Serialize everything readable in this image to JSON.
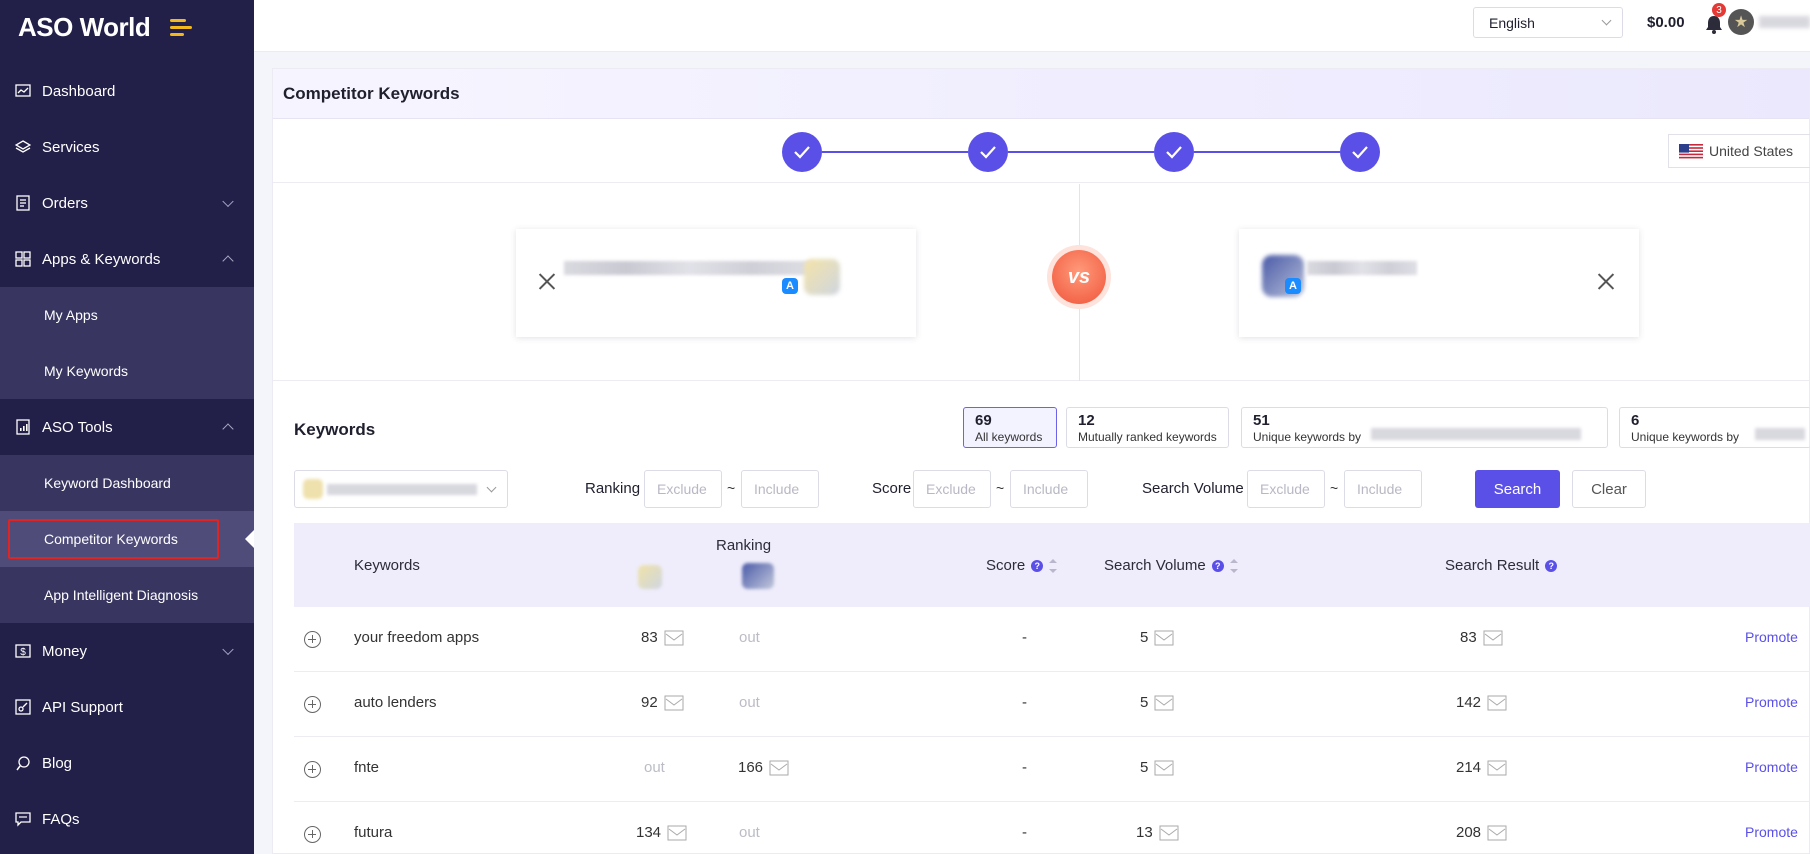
{
  "brand": {
    "logo_text": "ASO World",
    "accent": "#f2b81c"
  },
  "sidebar": {
    "items": [
      {
        "label": "Dashboard",
        "icon": "chart-line-icon"
      },
      {
        "label": "Services",
        "icon": "layers-icon"
      },
      {
        "label": "Orders",
        "icon": "document-icon"
      },
      {
        "label": "Apps & Keywords",
        "icon": "grid-icon"
      },
      {
        "label": "ASO Tools",
        "icon": "report-icon"
      },
      {
        "label": "Money",
        "icon": "dollar-icon"
      },
      {
        "label": "API Support",
        "icon": "api-icon"
      },
      {
        "label": "Blog",
        "icon": "blog-icon"
      },
      {
        "label": "FAQs",
        "icon": "chat-icon"
      }
    ],
    "apps_sub": [
      "My Apps",
      "My Keywords"
    ],
    "tools_sub": [
      "Keyword Dashboard",
      "Competitor Keywords",
      "App Intelligent Diagnosis"
    ]
  },
  "topbar": {
    "language": "English",
    "balance": "$0.00",
    "notifications": "3"
  },
  "page": {
    "title": "Competitor Keywords",
    "country": "United States",
    "vs_label": "vs",
    "store_glyph": "A"
  },
  "keywords": {
    "title": "Keywords",
    "tabs": [
      {
        "num": "69",
        "label": "All keywords"
      },
      {
        "num": "12",
        "label": "Mutually ranked keywords"
      },
      {
        "num": "51",
        "label": "Unique keywords by"
      },
      {
        "num": "6",
        "label": "Unique keywords by"
      }
    ]
  },
  "filters": {
    "ranking_label": "Ranking",
    "score_label": "Score",
    "volume_label": "Search Volume",
    "exclude_placeholder": "Exclude",
    "include_placeholder": "Include",
    "tilde": "~",
    "search_button": "Search",
    "clear_button": "Clear"
  },
  "table": {
    "headers": {
      "keywords": "Keywords",
      "ranking": "Ranking",
      "score": "Score",
      "search_volume": "Search Volume",
      "search_result": "Search Result",
      "help_glyph": "?"
    },
    "rows": [
      {
        "keyword": "your freedom apps",
        "rank1": "83",
        "rank2": "out",
        "score": "-",
        "volume": "5",
        "result": "83",
        "action": "Promote"
      },
      {
        "keyword": "auto lenders",
        "rank1": "92",
        "rank2": "out",
        "score": "-",
        "volume": "5",
        "result": "142",
        "action": "Promote"
      },
      {
        "keyword": "fnte",
        "rank1": "out",
        "rank2": "166",
        "score": "-",
        "volume": "5",
        "result": "214",
        "action": "Promote"
      },
      {
        "keyword": "futura",
        "rank1": "134",
        "rank2": "out",
        "score": "-",
        "volume": "13",
        "result": "208",
        "action": "Promote"
      }
    ]
  },
  "colors": {
    "primary": "#5a50e8",
    "sidebar_bg": "#221f48",
    "highlight": "#e02424"
  }
}
